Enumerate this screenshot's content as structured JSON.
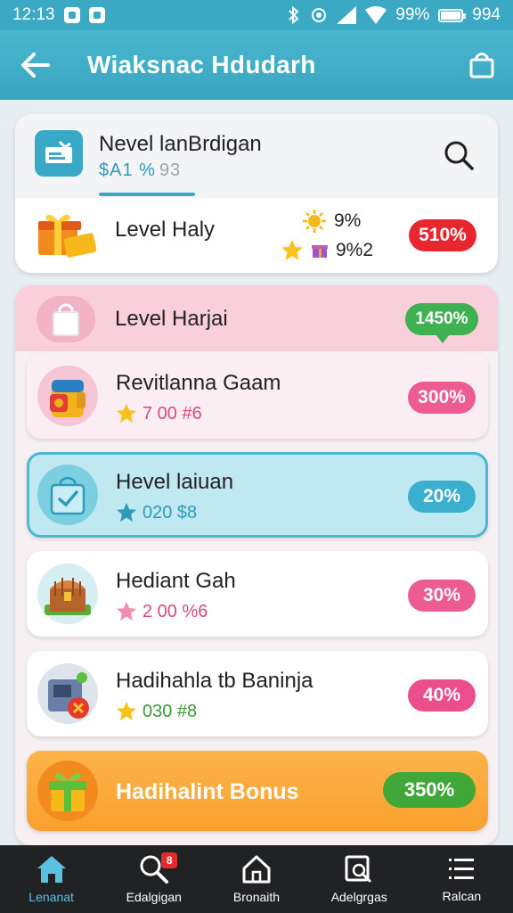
{
  "status_bar": {
    "time": "12:13",
    "battery_text": "99%",
    "right_number": "994"
  },
  "header": {
    "title": "Wiaksnac Hdudarh"
  },
  "top_card": {
    "title": "Nevel lanBrdigan",
    "subtitle_main": "$A1 %",
    "subtitle_sub": "93",
    "row_title": "Level Haly",
    "stat1": "9%",
    "stat2": "9%2",
    "badge": "510%"
  },
  "panel": {
    "title": "Level Harjai",
    "badge": "1450%"
  },
  "offers": [
    {
      "title": "Revitlanna Gaam",
      "sub": "7 00 #6",
      "badge": "300%"
    },
    {
      "title": "Hevel laiuan",
      "sub": "020 $8",
      "badge": "20%"
    },
    {
      "title": "Hediant Gah",
      "sub": "2 00 %6",
      "badge": "30%"
    },
    {
      "title": "Hadihahla tb Baninja",
      "sub": "030 #8",
      "badge": "40%"
    }
  ],
  "bonus": {
    "title": "Hadihalint Bonus",
    "badge": "350%"
  },
  "bottom_nav": {
    "items": [
      {
        "label": "Lenanat",
        "icon": "home-icon"
      },
      {
        "label": "Edalgigan",
        "icon": "search-icon",
        "badge": "8"
      },
      {
        "label": "Bronaith",
        "icon": "house-outline-icon"
      },
      {
        "label": "Adelgrgas",
        "icon": "search-document-icon"
      },
      {
        "label": "Ralcan",
        "icon": "menu-icon"
      }
    ]
  },
  "colors": {
    "accent": "#3ba9c4",
    "red_badge": "#e8262e",
    "green_badge": "#3fb150",
    "pink_badge": "#ec5c92",
    "blue_badge": "#3aafd0",
    "bonus_orange": "#f9a02f"
  }
}
